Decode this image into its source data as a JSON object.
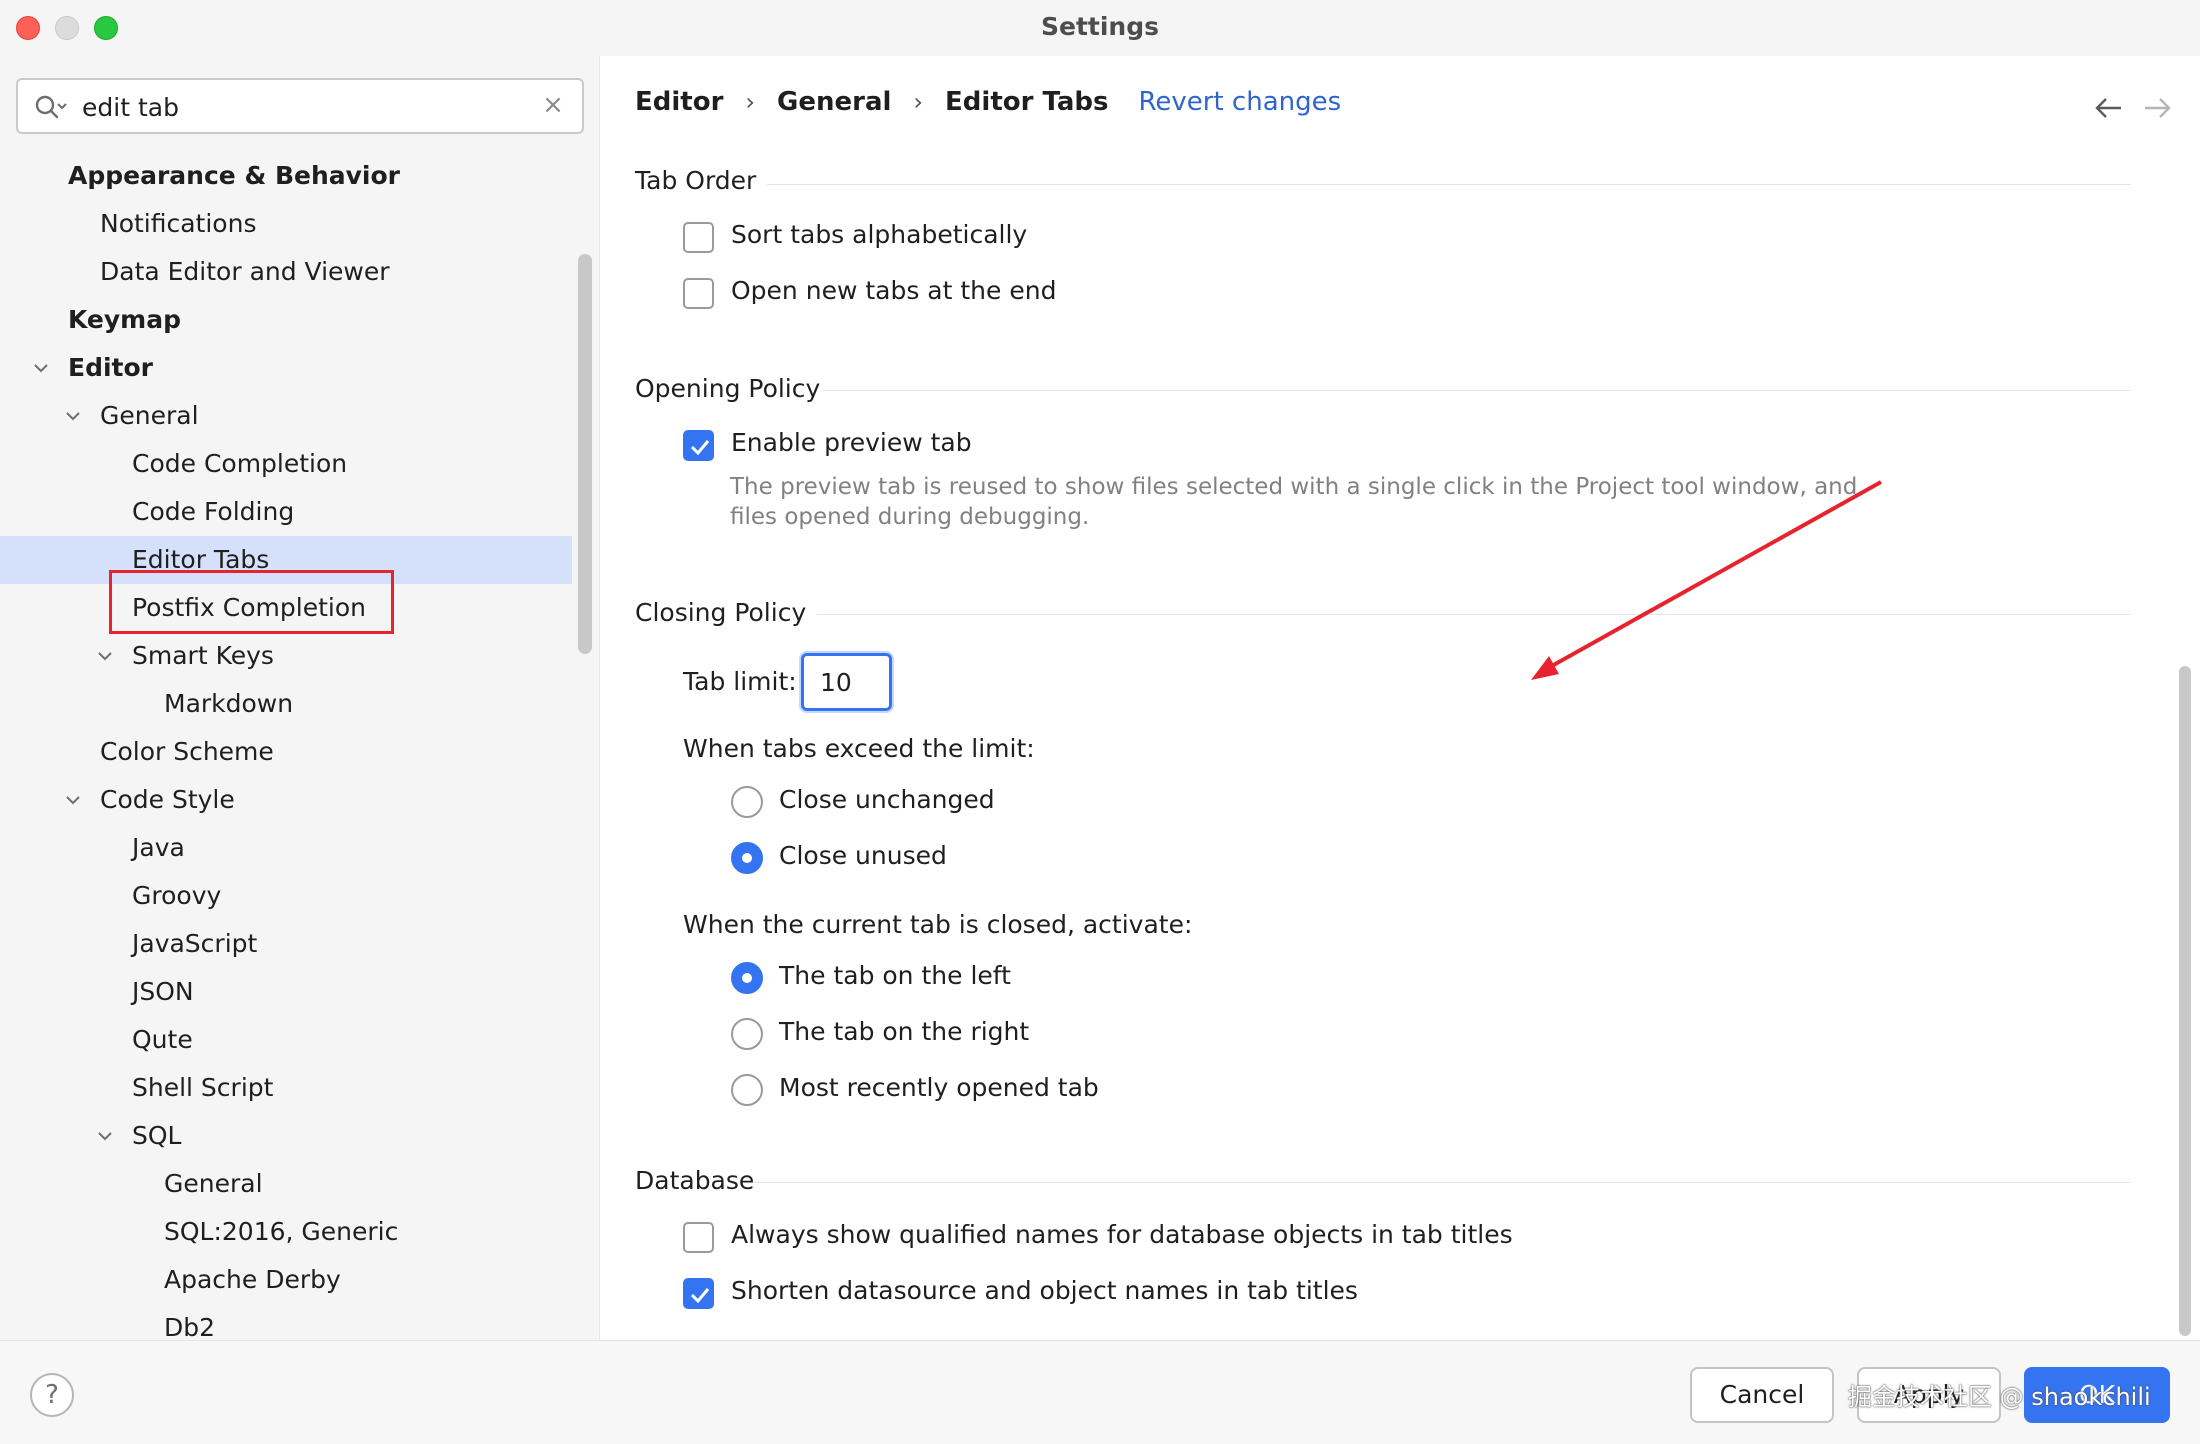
{
  "window": {
    "title": "Settings"
  },
  "search": {
    "value": "edit tab"
  },
  "tree": [
    {
      "label": "Appearance & Behavior",
      "level": 0,
      "bold": true
    },
    {
      "label": "Notifications",
      "level": 1
    },
    {
      "label": "Data Editor and Viewer",
      "level": 1
    },
    {
      "label": "Keymap",
      "level": 0,
      "bold": true
    },
    {
      "label": "Editor",
      "level": 0,
      "bold": true,
      "expanded": true
    },
    {
      "label": "General",
      "level": 1,
      "expanded": true
    },
    {
      "label": "Code Completion",
      "level": 2
    },
    {
      "label": "Code Folding",
      "level": 2
    },
    {
      "label": "Editor Tabs",
      "level": 2,
      "selected": true
    },
    {
      "label": "Postfix Completion",
      "level": 2
    },
    {
      "label": "Smart Keys",
      "level": 2,
      "expanded": true
    },
    {
      "label": "Markdown",
      "level": 3
    },
    {
      "label": "Color Scheme",
      "level": 1
    },
    {
      "label": "Code Style",
      "level": 1,
      "expanded": true
    },
    {
      "label": "Java",
      "level": 2
    },
    {
      "label": "Groovy",
      "level": 2
    },
    {
      "label": "JavaScript",
      "level": 2
    },
    {
      "label": "JSON",
      "level": 2
    },
    {
      "label": "Qute",
      "level": 2
    },
    {
      "label": "Shell Script",
      "level": 2
    },
    {
      "label": "SQL",
      "level": 2,
      "expanded": true
    },
    {
      "label": "General",
      "level": 3
    },
    {
      "label": "SQL:2016, Generic",
      "level": 3
    },
    {
      "label": "Apache Derby",
      "level": 3
    },
    {
      "label": "Db2",
      "level": 3
    }
  ],
  "breadcrumb": {
    "items": [
      "Editor",
      "General",
      "Editor Tabs"
    ],
    "revert": "Revert changes"
  },
  "sections": {
    "tab_order": {
      "title": "Tab Order",
      "sort_alpha": {
        "label": "Sort tabs alphabetically",
        "checked": false
      },
      "open_end": {
        "label": "Open new tabs at the end",
        "checked": false
      }
    },
    "opening_policy": {
      "title": "Opening Policy",
      "preview": {
        "label": "Enable preview tab",
        "checked": true
      },
      "hint_line1": "The preview tab is reused to show files selected with a single click in the Project tool window, and",
      "hint_line2": "files opened during debugging."
    },
    "closing_policy": {
      "title": "Closing Policy",
      "tab_limit_label": "Tab limit:",
      "tab_limit_value": "10",
      "exceed_label": "When tabs exceed the limit:",
      "exceed_options": [
        {
          "label": "Close unchanged",
          "checked": false
        },
        {
          "label": "Close unused",
          "checked": true
        }
      ],
      "activate_label": "When the current tab is closed, activate:",
      "activate_options": [
        {
          "label": "The tab on the left",
          "checked": true
        },
        {
          "label": "The tab on the right",
          "checked": false
        },
        {
          "label": "Most recently opened tab",
          "checked": false
        }
      ]
    },
    "database": {
      "title": "Database",
      "qualified": {
        "label": "Always show qualified names for database objects in tab titles",
        "checked": false
      },
      "shorten": {
        "label": "Shorten datasource and object names in tab titles",
        "checked": true
      }
    }
  },
  "buttons": {
    "help": "?",
    "cancel": "Cancel",
    "apply": "Apply",
    "ok": "OK"
  },
  "watermark": "掘金技术社区 @ shaokchili",
  "colors": {
    "accent": "#3574f0",
    "selection": "#d5e1fb",
    "annotation": "#e8232d",
    "link": "#2f65ca"
  }
}
